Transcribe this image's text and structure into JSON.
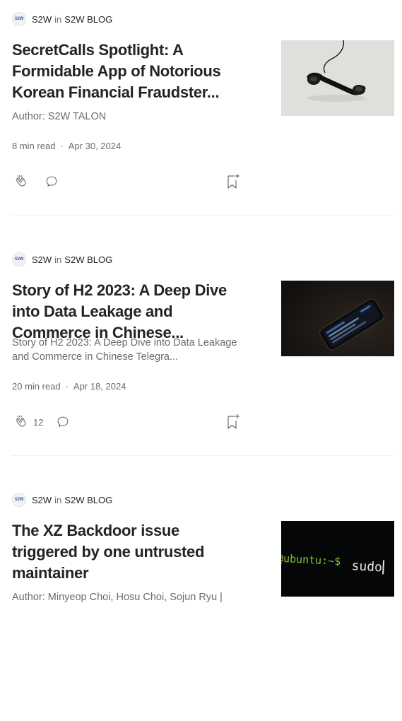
{
  "articles": [
    {
      "author": "S2W",
      "in_word": "in",
      "publication": "S2W BLOG",
      "avatar_text": "S2W",
      "title": "SecretCalls Spotlight: A Formidable App of Notorious Korean Financial Fraudster...",
      "subtitle": "Author: S2W TALON",
      "read_time": "8 min read",
      "dot": "·",
      "date": "Apr 30, 2024",
      "claps": "",
      "image": "telephone-handset-photo"
    },
    {
      "author": "S2W",
      "in_word": "in",
      "publication": "S2W BLOG",
      "avatar_text": "S2W",
      "title": "Story of H2 2023: A Deep Dive into Data Leakage and Commerce in Chinese...",
      "subtitle": "Story of H2 2023: A Deep Dive into Data Leakage and Commerce in Chinese Telegra...",
      "read_time": "20 min read",
      "dot": "·",
      "date": "Apr 18, 2024",
      "claps": "12",
      "image": "smartphone-dark-photo"
    },
    {
      "author": "S2W",
      "in_word": "in",
      "publication": "S2W BLOG",
      "avatar_text": "S2W",
      "title": "The XZ Backdoor issue triggered by one untrusted maintainer",
      "subtitle": "Author: Minyeop Choi, Hosu Choi, Sojun Ryu |",
      "read_time": "",
      "dot": "",
      "date": "",
      "claps": "",
      "image": "terminal-sudo-photo",
      "terminal_prompt": "@ubuntu:~$",
      "terminal_command": "sudo"
    }
  ],
  "colors": {
    "text_primary": "#242424",
    "text_secondary": "#6b6b6b",
    "divider": "#f2f2f2"
  }
}
